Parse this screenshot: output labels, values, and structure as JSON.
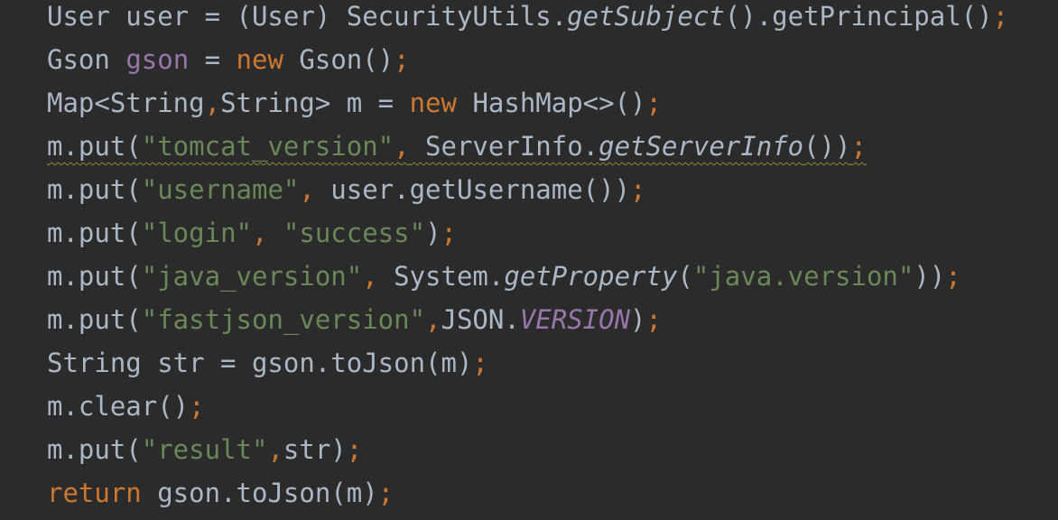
{
  "editor": {
    "lines": [
      [
        {
          "t": "User user = (User) SecurityUtils.",
          "c": "plain"
        },
        {
          "t": "getSubject",
          "c": "italic"
        },
        {
          "t": "().getPrincipal()",
          "c": "plain"
        },
        {
          "t": ";",
          "c": "punc"
        }
      ],
      [
        {
          "t": "Gson ",
          "c": "plain"
        },
        {
          "t": "gson",
          "c": "field"
        },
        {
          "t": " = ",
          "c": "plain"
        },
        {
          "t": "new",
          "c": "kw"
        },
        {
          "t": " Gson()",
          "c": "plain"
        },
        {
          "t": ";",
          "c": "punc"
        }
      ],
      [
        {
          "t": "Map<String",
          "c": "plain"
        },
        {
          "t": ",",
          "c": "punc"
        },
        {
          "t": "String> m = ",
          "c": "plain"
        },
        {
          "t": "new",
          "c": "kw"
        },
        {
          "t": " HashMap<>()",
          "c": "plain"
        },
        {
          "t": ";",
          "c": "punc"
        }
      ],
      [
        {
          "t": "m.put(",
          "c": "plain"
        },
        {
          "t": "\"tomcat_version\"",
          "c": "str"
        },
        {
          "t": ",",
          "c": "punc"
        },
        {
          "t": " ServerInfo.",
          "c": "plain"
        },
        {
          "t": "getServerInfo",
          "c": "italic"
        },
        {
          "t": "())",
          "c": "plain"
        },
        {
          "t": ";",
          "c": "punc"
        }
      ],
      [
        {
          "t": "m.put(",
          "c": "plain"
        },
        {
          "t": "\"username\"",
          "c": "str"
        },
        {
          "t": ",",
          "c": "punc"
        },
        {
          "t": " user.getUsername())",
          "c": "plain"
        },
        {
          "t": ";",
          "c": "punc"
        }
      ],
      [
        {
          "t": "m.put(",
          "c": "plain"
        },
        {
          "t": "\"login\"",
          "c": "str"
        },
        {
          "t": ",",
          "c": "punc"
        },
        {
          "t": " ",
          "c": "plain"
        },
        {
          "t": "\"success\"",
          "c": "str"
        },
        {
          "t": ")",
          "c": "plain"
        },
        {
          "t": ";",
          "c": "punc"
        }
      ],
      [
        {
          "t": "m.put(",
          "c": "plain"
        },
        {
          "t": "\"java_version\"",
          "c": "str"
        },
        {
          "t": ",",
          "c": "punc"
        },
        {
          "t": " System.",
          "c": "plain"
        },
        {
          "t": "getProperty",
          "c": "italic"
        },
        {
          "t": "(",
          "c": "plain"
        },
        {
          "t": "\"java.version\"",
          "c": "str"
        },
        {
          "t": "))",
          "c": "plain"
        },
        {
          "t": ";",
          "c": "punc"
        }
      ],
      [
        {
          "t": "m.put(",
          "c": "plain"
        },
        {
          "t": "\"fastjson_version\"",
          "c": "str"
        },
        {
          "t": ",",
          "c": "punc"
        },
        {
          "t": "JSON.",
          "c": "plain"
        },
        {
          "t": "VERSION",
          "c": "const"
        },
        {
          "t": ")",
          "c": "plain"
        },
        {
          "t": ";",
          "c": "punc"
        }
      ],
      [
        {
          "t": "String str = gson.toJson(m)",
          "c": "plain"
        },
        {
          "t": ";",
          "c": "punc"
        }
      ],
      [
        {
          "t": "m.clear()",
          "c": "plain"
        },
        {
          "t": ";",
          "c": "punc"
        }
      ],
      [
        {
          "t": "m.put(",
          "c": "plain"
        },
        {
          "t": "\"result\"",
          "c": "str"
        },
        {
          "t": ",",
          "c": "punc"
        },
        {
          "t": "str)",
          "c": "plain"
        },
        {
          "t": ";",
          "c": "punc"
        }
      ],
      [
        {
          "t": "return",
          "c": "kw"
        },
        {
          "t": " gson.toJson(m)",
          "c": "plain"
        },
        {
          "t": ";",
          "c": "punc"
        }
      ]
    ],
    "warning_line_index": 3
  }
}
